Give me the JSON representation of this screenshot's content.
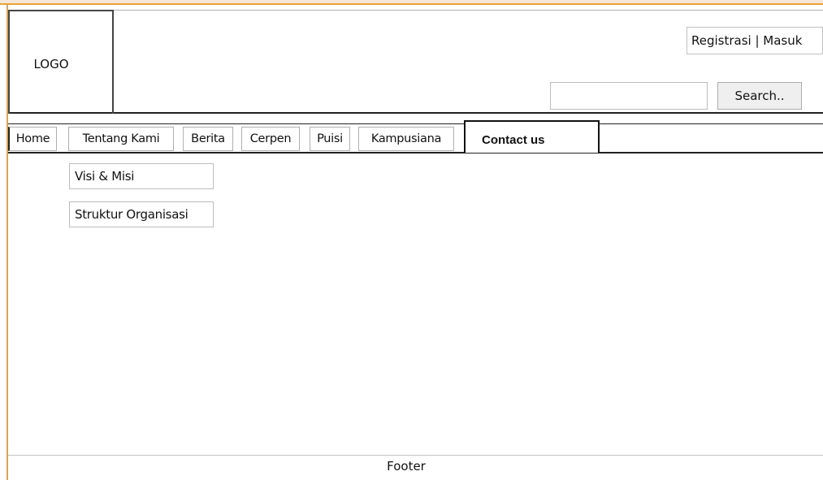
{
  "header": {
    "logo_label": "LOGO",
    "auth_links": "Registrasi | Masuk",
    "search": {
      "placeholder": "",
      "button_label": "Search.."
    }
  },
  "nav": {
    "items": [
      {
        "label": "Home"
      },
      {
        "label": "Tentang Kami"
      },
      {
        "label": "Berita"
      },
      {
        "label": "Cerpen"
      },
      {
        "label": "Puisi"
      },
      {
        "label": "Kampusiana"
      },
      {
        "label": "Contact us"
      }
    ]
  },
  "submenu": {
    "items": [
      {
        "label": "Visi & Misi"
      },
      {
        "label": "Struktur Organisasi"
      }
    ]
  },
  "footer": {
    "label": "Footer"
  },
  "colors": {
    "frame_accent": "#e8a13a",
    "border_dark": "#222222",
    "border_light": "#b0b0b0",
    "button_bg": "#efefef"
  }
}
